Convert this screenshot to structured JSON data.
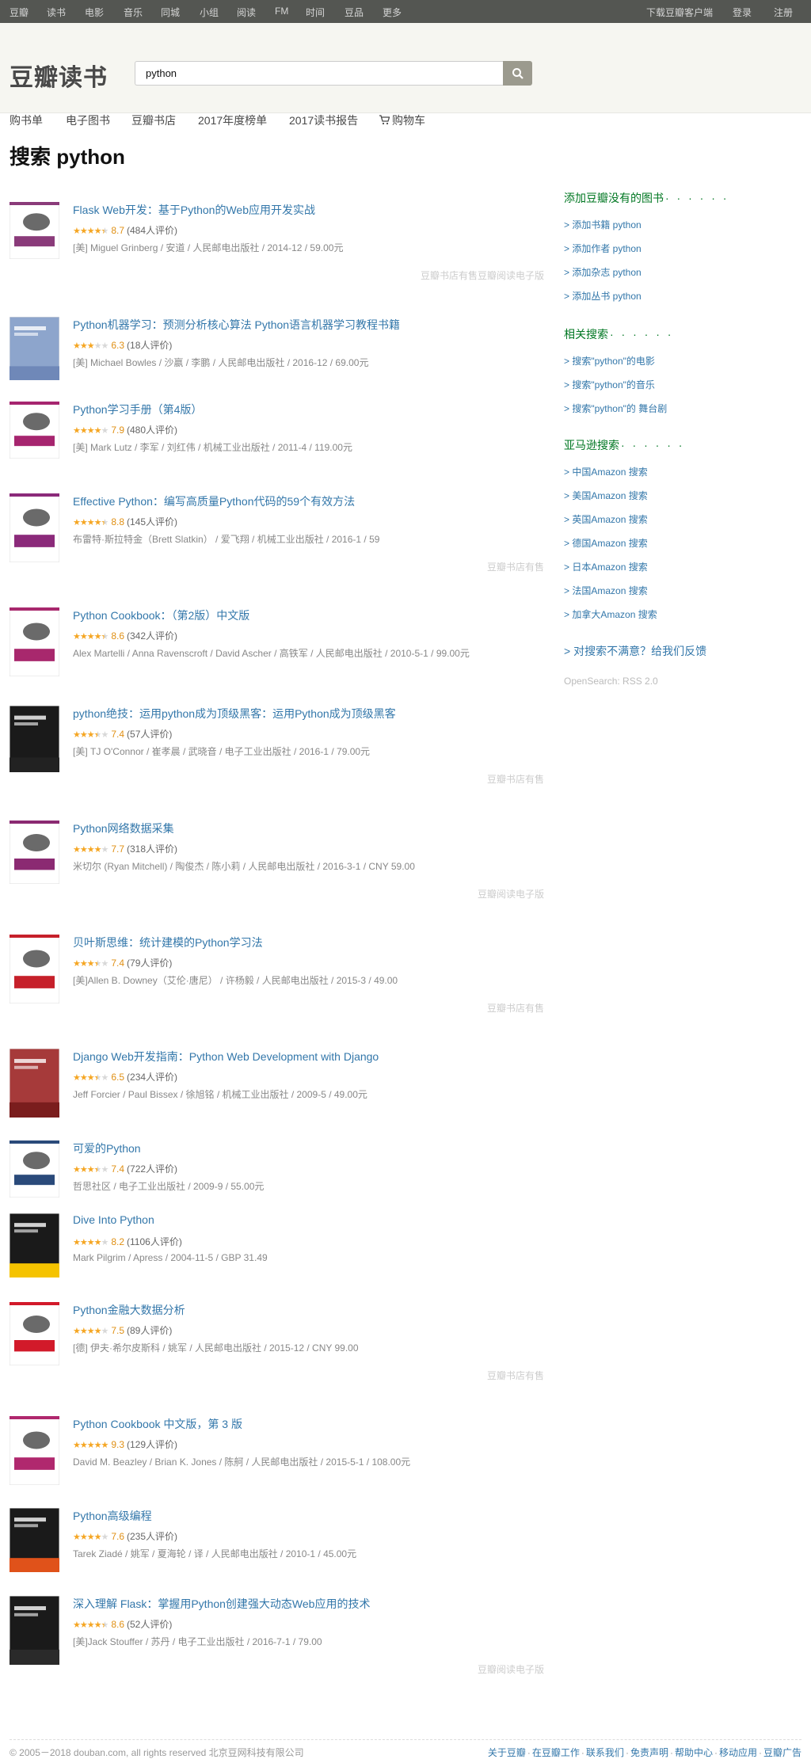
{
  "topbar": {
    "links": [
      "豆瓣",
      "读书",
      "电影",
      "音乐",
      "同城",
      "小组",
      "阅读",
      "FM",
      "时间",
      "豆品",
      "更多"
    ],
    "right": [
      "下载豆瓣客户端",
      "登录",
      "注册"
    ]
  },
  "header": {
    "logo": "豆瓣读书",
    "search_value": "python",
    "search_icon": "search-icon",
    "subnav": [
      "购书单",
      "电子图书",
      "豆瓣书店",
      "2017年度榜单",
      "2017读书报告",
      "购物车"
    ],
    "cart_icon": "cart-icon"
  },
  "page_title": "搜索 python",
  "results": [
    {
      "title": "Flask Web开发：基于Python的Web应用开发实战",
      "stars": 4.5,
      "score": "8.7",
      "count": "(484人评价)",
      "meta": "[美] Miguel Grinberg / 安道 / 人民邮电出版社 / 2014-12 / 59.00元",
      "links": [
        "豆瓣书店有售",
        "豆瓣阅读电子版"
      ],
      "cover_color": "#ffffff"
    },
    {
      "title": "Python机器学习：预测分析核心算法 Python语言机器学习教程书籍",
      "stars": 3,
      "score": "6.3",
      "count": "(18人评价)",
      "meta": "[美] Michael Bowles / 沙嬴 / 李鹏 / 人民邮电出版社 / 2016-12 / 69.00元",
      "links": [],
      "cover_color": "#8da5cc"
    },
    {
      "title": "Python学习手册（第4版）",
      "stars": 4,
      "score": "7.9",
      "count": "(480人评价)",
      "meta": "[美] Mark Lutz / 李军 / 刘红伟 / 机械工业出版社 / 2011-4 / 119.00元",
      "links": [],
      "cover_color": "#ffffff"
    },
    {
      "title": "Effective Python：编写高质量Python代码的59个有效方法",
      "stars": 4.5,
      "score": "8.8",
      "count": "(145人评价)",
      "meta": "布雷特·斯拉特金（Brett Slatkin） / 爱飞翔 / 机械工业出版社 / 2016-1 / 59",
      "links": [
        "豆瓣书店有售"
      ],
      "cover_color": "#ffffff"
    },
    {
      "title": "Python Cookbook：（第2版）中文版",
      "stars": 4.5,
      "score": "8.6",
      "count": "(342人评价)",
      "meta": "Alex Martelli / Anna Ravenscroft / David Ascher / 高铁军 / 人民邮电出版社 / 2010-5-1 / 99.00元",
      "links": [],
      "cover_color": "#ffffff"
    },
    {
      "title": "python绝技：运用python成为顶级黑客：运用Python成为顶级黑客",
      "stars": 3.5,
      "score": "7.4",
      "count": "(57人评价)",
      "meta": "[美] TJ O'Connor / 崔孝晨 / 武晓音 / 电子工业出版社 / 2016-1 / 79.00元",
      "links": [
        "豆瓣书店有售"
      ],
      "cover_color": "#1a1a1a"
    },
    {
      "title": "Python网络数据采集",
      "stars": 4,
      "score": "7.7",
      "count": "(318人评价)",
      "meta": "米切尔 (Ryan Mitchell) / 陶俊杰 / 陈小莉 / 人民邮电出版社 / 2016-3-1 / CNY 59.00",
      "links": [
        "豆瓣阅读电子版"
      ],
      "cover_color": "#ffffff"
    },
    {
      "title": "贝叶斯思维：统计建模的Python学习法",
      "stars": 3.5,
      "score": "7.4",
      "count": "(79人评价)",
      "meta": "[美]Allen B. Downey（艾伦·唐尼） / 许杨毅 / 人民邮电出版社 / 2015-3 / 49.00",
      "links": [
        "豆瓣书店有售"
      ],
      "cover_color": "#ffffff"
    },
    {
      "title": "Django Web开发指南：Python Web Development with Django",
      "stars": 3.5,
      "score": "6.5",
      "count": "(234人评价)",
      "meta": "Jeff Forcier / Paul Bissex / 徐旭铭 / 机械工业出版社 / 2009-5 / 49.00元",
      "links": [],
      "cover_color": "#a63a3a"
    },
    {
      "title": "可爱的Python",
      "stars": 3.5,
      "score": "7.4",
      "count": "(722人评价)",
      "meta": "哲思社区 / 电子工业出版社 / 2009-9 / 55.00元",
      "links": [],
      "cover_color": "#ffffff"
    },
    {
      "title": "Dive Into Python",
      "stars": 4,
      "score": "8.2",
      "count": "(1106人评价)",
      "meta": "Mark Pilgrim / Apress / 2004-11-5 / GBP 31.49",
      "links": [],
      "cover_color": "#1a1a1a"
    },
    {
      "title": "Python金融大数据分析",
      "stars": 4,
      "score": "7.5",
      "count": "(89人评价)",
      "meta": "[德] 伊夫·希尔皮斯科 / 姚军 / 人民邮电出版社 / 2015-12 / CNY 99.00",
      "links": [
        "豆瓣书店有售"
      ],
      "cover_color": "#ffffff"
    },
    {
      "title": "Python Cookbook 中文版，第 3 版",
      "stars": 5,
      "score": "9.3",
      "count": "(129人评价)",
      "meta": "David M. Beazley / Brian K. Jones / 陈舸 / 人民邮电出版社 / 2015-5-1 / 108.00元",
      "links": [],
      "cover_color": "#ffffff"
    },
    {
      "title": "Python高级编程",
      "stars": 4,
      "score": "7.6",
      "count": "(235人评价)",
      "meta": "Tarek Ziadé / 姚军 / 夏海轮 / 译 / 人民邮电出版社 / 2010-1 / 45.00元",
      "links": [],
      "cover_color": "#1a1a1a"
    },
    {
      "title": "深入理解 Flask：掌握用Python创建强大动态Web应用的技术",
      "stars": 4.5,
      "score": "8.6",
      "count": "(52人评价)",
      "meta": "[美]Jack Stouffer / 苏丹 / 电子工业出版社 / 2016-7-1 / 79.00",
      "links": [
        "豆瓣阅读电子版"
      ],
      "cover_color": "#1a1a1a"
    }
  ],
  "aside": {
    "add_heading": "添加豆瓣没有的图书",
    "add_links": [
      "> 添加书籍 python",
      "> 添加作者 python",
      "> 添加杂志 python",
      "> 添加丛书 python"
    ],
    "related_heading": "相关搜索",
    "related_links": [
      "> 搜索\"python\"的电影",
      "> 搜索\"python\"的音乐",
      "> 搜索\"python\"的 舞台剧"
    ],
    "amazon_heading": "亚马逊搜索",
    "amazon_links": [
      "> 中国Amazon 搜索",
      "> 美国Amazon 搜索",
      "> 英国Amazon 搜索",
      "> 德国Amazon 搜索",
      "> 日本Amazon 搜索",
      "> 法国Amazon 搜索",
      "> 加拿大Amazon 搜索"
    ],
    "feedback": "> 对搜索不满意？给我们反馈",
    "opensearch": "OpenSearch: RSS 2.0",
    "dots": "· · · · · ·"
  },
  "footer": {
    "copyright": "© 2005－2018 douban.com, all rights reserved 北京豆网科技有限公司",
    "links": [
      "关于豆瓣",
      "在豆瓣工作",
      "联系我们",
      "免责声明",
      "帮助中心",
      "移动应用",
      "豆瓣广告"
    ]
  }
}
